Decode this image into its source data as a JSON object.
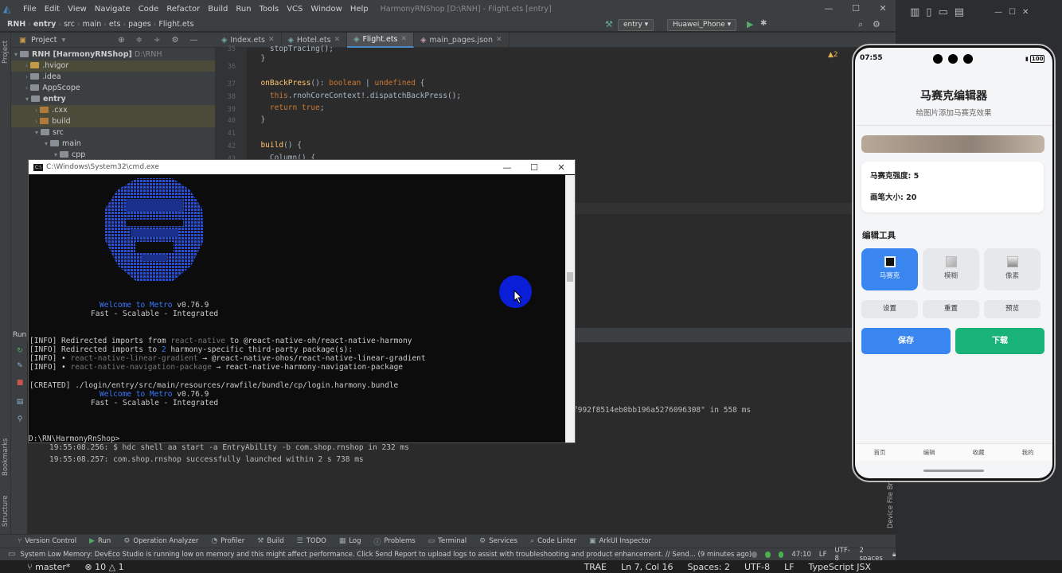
{
  "ide": {
    "window_title": "HarmonyRNShop [D:\\RNH] - Flight.ets [entry]",
    "menu": [
      "File",
      "Edit",
      "View",
      "Navigate",
      "Code",
      "Refactor",
      "Build",
      "Run",
      "Tools",
      "VCS",
      "Window",
      "Help"
    ],
    "breadcrumb": [
      "RNH",
      "entry",
      "src",
      "main",
      "ets",
      "pages",
      "Flight.ets"
    ],
    "run_config": "entry",
    "device": "Huawei_Phone",
    "project_label": "Project",
    "editor_tabs": [
      {
        "label": "Index.ets",
        "active": false
      },
      {
        "label": "Hotel.ets",
        "active": false
      },
      {
        "label": "Flight.ets",
        "active": true
      },
      {
        "label": "main_pages.json",
        "active": false
      }
    ],
    "tree": [
      {
        "label": "RNH [HarmonyRNShop]",
        "hint": "D:\\RNH",
        "depth": 0,
        "open": true
      },
      {
        "label": ".hvigor",
        "depth": 1,
        "open": false
      },
      {
        "label": ".idea",
        "depth": 1,
        "open": false
      },
      {
        "label": "AppScope",
        "depth": 1,
        "open": false
      },
      {
        "label": "entry",
        "depth": 1,
        "open": true
      },
      {
        "label": ".cxx",
        "depth": 2,
        "open": false
      },
      {
        "label": "build",
        "depth": 2,
        "open": false
      },
      {
        "label": "src",
        "depth": 2,
        "open": true
      },
      {
        "label": "main",
        "depth": 3,
        "open": true
      },
      {
        "label": "cpp",
        "depth": 4,
        "open": true
      }
    ],
    "line_numbers": [
      "35",
      "36",
      "37",
      "38",
      "39",
      "40",
      "41",
      "42",
      "43"
    ],
    "code_lines": [
      "    stopTracing();",
      "  }",
      "",
      "  onBackPress(): boolean | undefined {",
      "    this.rnohCoreContext!.dispatchBackPress();",
      "    return true;",
      "  }",
      "",
      "  build() {",
      "    Column() {"
    ],
    "inspection": "2",
    "run_tab": "Run",
    "run_output": [
      "f992f8514eb0bb196a5276096308\" in 558 ms",
      "19:55:08.256: $ hdc shell aa start -a EntryAbility -b com.shop.rnshop in 232 ms",
      "19:55:08.257: com.shop.rnshop successfully launched within 2 s 738 ms"
    ],
    "side_tabs": [
      "Project",
      "Bookmarks",
      "Structure"
    ],
    "right_side_tab": "Device File Browser",
    "bottom_tools": [
      "Version Control",
      "Run",
      "Operation Analyzer",
      "Profiler",
      "Build",
      "TODO",
      "Log",
      "Problems",
      "Terminal",
      "Services",
      "Code Linter",
      "ArkUI Inspector"
    ],
    "status_message": "System Low Memory: DevEco Studio is running low on memory and this might affect performance. Click Send Report to upload logs to assist with troubleshooting and product enhancement. // Send... (9 minutes ago)",
    "status_right": [
      "47:10",
      "LF",
      "UTF-8",
      "2 spaces"
    ]
  },
  "cmd": {
    "title": "C:\\Windows\\System32\\cmd.exe",
    "welcome_prefix": "Welcome to ",
    "welcome_metro": "Metro",
    "version": " v0.76.9",
    "tagline": "Fast - Scalable - Integrated",
    "info1_a": "[INFO] Redirected imports from ",
    "info1_b": "react-native",
    "info1_c": " to @react-native-oh/react-native-harmony",
    "info2_a": "[INFO] Redirected imports to ",
    "info2_b": "2",
    "info2_c": " harmony-specific third-party package(s):",
    "info3_a": "[INFO] • ",
    "info3_b": "react-native-linear-gradient",
    "info3_c": " → @react-native-ohos/react-native-linear-gradient",
    "info4_a": "[INFO] • ",
    "info4_b": "react-native-navigation-package",
    "info4_c": " → react-native-harmony-navigation-package",
    "created": "[CREATED] ./login/entry/src/main/resources/rawfile/bundle/cp/login.harmony.bundle",
    "prompt": "D:\\RN\\HarmonyRnShop>"
  },
  "phone": {
    "time": "07:55",
    "battery": "100",
    "title": "马赛克编辑器",
    "subtitle": "给图片添加马赛克效果",
    "strength_label": "马赛克强度: 5",
    "brush_label": "画笔大小: 20",
    "tools_heading": "编辑工具",
    "tools": [
      {
        "label": "马赛克",
        "active": true
      },
      {
        "label": "模糊",
        "active": false
      },
      {
        "label": "像素",
        "active": false
      }
    ],
    "small_buttons": [
      "设置",
      "重置",
      "预览"
    ],
    "save": "保存",
    "download": "下载",
    "nav": [
      "首页",
      "编辑",
      "收藏",
      "我的"
    ],
    "colors": {
      "save": "#3a86f0",
      "download": "#19b37a",
      "active_tool": "#3a86f0"
    }
  },
  "taskbar": {
    "branch": "master*",
    "errors": "10",
    "warnings": "1",
    "trae": "TRAE",
    "position": "Ln 7, Col 16",
    "spaces": "Spaces: 2",
    "encoding": "UTF-8",
    "eol": "LF",
    "language": "TypeScript JSX"
  }
}
